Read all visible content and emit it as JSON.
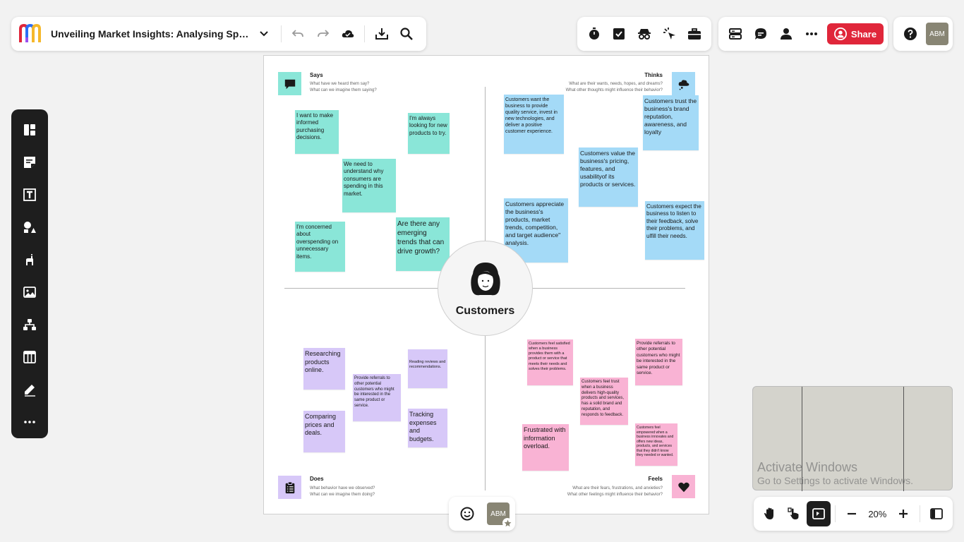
{
  "header": {
    "board_title": "Unveiling Market Insights: Analysing Spend...",
    "share_label": "Share",
    "user_initials": "ABM"
  },
  "board": {
    "center_label": "Customers",
    "says": {
      "title": "Says",
      "sub1": "What have we heard them say?",
      "sub2": "What can we imagine them saying?"
    },
    "thinks": {
      "title": "Thinks",
      "sub1": "What are their wants, needs, hopes, and dreams?",
      "sub2": "What other thoughts might influence their behavior?"
    },
    "does": {
      "title": "Does",
      "sub1": "What behavior have we observed?",
      "sub2": "What can we imagine them doing?"
    },
    "feels": {
      "title": "Feels",
      "sub1": "What are their fears, frustrations, and anxieties?",
      "sub2": "What other feelings might influence their behavior?"
    },
    "notes": [
      "I want to make informed purchasing decisions.",
      "I'm always looking for new products to try.",
      "We need to understand why consumers are spending in this market.",
      "I'm concerned about overspending on unnecessary items.",
      "Are there any emerging trends that can drive growth?",
      "Customers want the business to provide quality service, invest in new technologies, and deliver a positive customer experience.",
      "Customers trust the business's brand reputation, awareness, and loyalty",
      "Customers value the business's pricing, features, and usabilityof its products or services.",
      "Customers appreciate the business's products, market trends, competition, and target audience\" analysis.",
      "Customers expect the business to listen to their feedback, solve their problems, and ulfill their needs.",
      "Researching products online.",
      "Provide referrals to other potential customers who might be interested in the same product or service.",
      "Reading reviews and recommendations.",
      "Comparing prices and deals.",
      "Tracking expenses and budgets.",
      "Customers feel satisfied when a business provides them with a product or service that meets their needs and solves their problems.",
      "Provide referrals to other potential customers who might be interested in the same product or service.",
      "Customers feel trust when a business delivers high-quality products and services, has a solid brand and reputation, and responds to feedback.",
      "Frustrated with information overload.",
      "Customers feel empowered when a business innovates and offers new ideas, products, and services that they didn't know they needed or wanted."
    ]
  },
  "footer": {
    "reaction_initials": "ABM",
    "zoom": "20%",
    "watermark_title": "Activate Windows",
    "watermark_sub": "Go to Settings to activate Windows."
  },
  "colors": {
    "teal": "#8ae6d8",
    "blue": "#a4daf7",
    "purple": "#d7c8f8",
    "pink": "#f9b3d4",
    "share": "#e0263a"
  }
}
